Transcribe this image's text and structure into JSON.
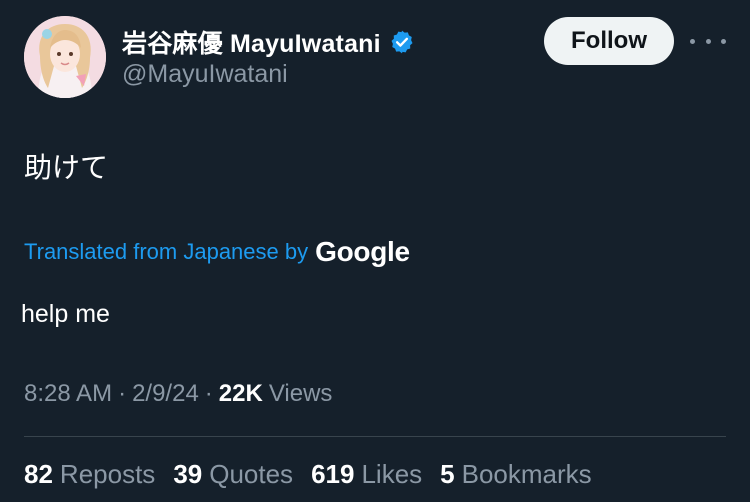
{
  "author": {
    "display_name": "岩谷麻優 MayuIwatani",
    "handle": "@MayuIwatani",
    "verified_icon": "verified-badge-icon",
    "avatar_icon": "profile-avatar"
  },
  "actions": {
    "follow_label": "Follow",
    "more_icon": "more-horizontal-icon"
  },
  "tweet": {
    "text": "助けて",
    "translation_label": "Translated from Japanese by",
    "translation_provider": "Google",
    "translated_text": "help me"
  },
  "meta": {
    "time": "8:28 AM",
    "date": "2/9/24",
    "views_count": "22K",
    "views_label": "Views",
    "separator": "·"
  },
  "stats": [
    {
      "count": "82",
      "label": "Reposts"
    },
    {
      "count": "39",
      "label": "Quotes"
    },
    {
      "count": "619",
      "label": "Likes"
    },
    {
      "count": "5",
      "label": "Bookmarks"
    }
  ],
  "colors": {
    "background": "#15202b",
    "accent": "#1d9bf0",
    "muted": "#8b98a5",
    "divider": "#38444d"
  }
}
